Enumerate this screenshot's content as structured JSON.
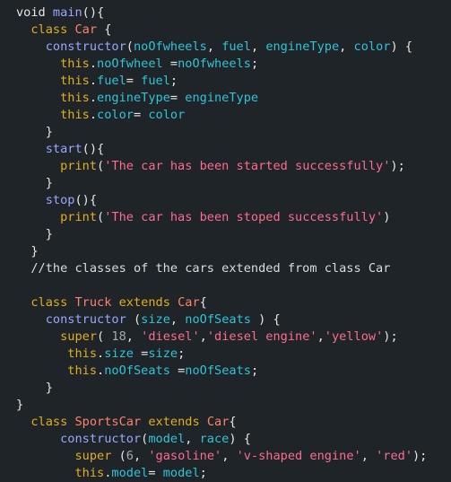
{
  "colors": {
    "background": "#1f2428",
    "plain": "#e6e6e6",
    "keyword": "#e0ae20",
    "function": "#9aa6ff",
    "class_name": "#ff8269",
    "property": "#2fc4d8",
    "string": "#ff6b8f",
    "number": "#a6aab1"
  },
  "lines": [
    [
      {
        "t": "plain",
        "v": "void "
      },
      {
        "t": "fn",
        "v": "main"
      },
      {
        "t": "plain",
        "v": "(){"
      }
    ],
    [
      {
        "t": "plain",
        "v": "  "
      },
      {
        "t": "kw",
        "v": "class"
      },
      {
        "t": "plain",
        "v": " "
      },
      {
        "t": "cls",
        "v": "Car"
      },
      {
        "t": "plain",
        "v": " {"
      }
    ],
    [
      {
        "t": "plain",
        "v": "    "
      },
      {
        "t": "fn",
        "v": "constructor"
      },
      {
        "t": "plain",
        "v": "("
      },
      {
        "t": "attr",
        "v": "noOfwheels"
      },
      {
        "t": "plain",
        "v": ", "
      },
      {
        "t": "attr",
        "v": "fuel"
      },
      {
        "t": "plain",
        "v": ", "
      },
      {
        "t": "attr",
        "v": "engineType"
      },
      {
        "t": "plain",
        "v": ", "
      },
      {
        "t": "attr",
        "v": "color"
      },
      {
        "t": "plain",
        "v": ") {"
      }
    ],
    [
      {
        "t": "plain",
        "v": "      "
      },
      {
        "t": "kw",
        "v": "this"
      },
      {
        "t": "plain",
        "v": "."
      },
      {
        "t": "attr",
        "v": "noOfwheel"
      },
      {
        "t": "plain",
        "v": " ="
      },
      {
        "t": "attr",
        "v": "noOfwheels"
      },
      {
        "t": "plain",
        "v": ";"
      }
    ],
    [
      {
        "t": "plain",
        "v": "      "
      },
      {
        "t": "kw",
        "v": "this"
      },
      {
        "t": "plain",
        "v": "."
      },
      {
        "t": "attr",
        "v": "fuel"
      },
      {
        "t": "plain",
        "v": "= "
      },
      {
        "t": "attr",
        "v": "fuel"
      },
      {
        "t": "plain",
        "v": ";"
      }
    ],
    [
      {
        "t": "plain",
        "v": "      "
      },
      {
        "t": "kw",
        "v": "this"
      },
      {
        "t": "plain",
        "v": "."
      },
      {
        "t": "attr",
        "v": "engineType"
      },
      {
        "t": "plain",
        "v": "= "
      },
      {
        "t": "attr",
        "v": "engineType"
      }
    ],
    [
      {
        "t": "plain",
        "v": "      "
      },
      {
        "t": "kw",
        "v": "this"
      },
      {
        "t": "plain",
        "v": "."
      },
      {
        "t": "attr",
        "v": "color"
      },
      {
        "t": "plain",
        "v": "= "
      },
      {
        "t": "attr",
        "v": "color"
      }
    ],
    [
      {
        "t": "plain",
        "v": "    }"
      }
    ],
    [
      {
        "t": "plain",
        "v": "    "
      },
      {
        "t": "fn",
        "v": "start"
      },
      {
        "t": "plain",
        "v": "(){"
      }
    ],
    [
      {
        "t": "plain",
        "v": "      "
      },
      {
        "t": "kw",
        "v": "print"
      },
      {
        "t": "plain",
        "v": "("
      },
      {
        "t": "str",
        "v": "'The car has been started successfully'"
      },
      {
        "t": "plain",
        "v": ");"
      }
    ],
    [
      {
        "t": "plain",
        "v": "    }"
      }
    ],
    [
      {
        "t": "plain",
        "v": "    "
      },
      {
        "t": "fn",
        "v": "stop"
      },
      {
        "t": "plain",
        "v": "(){"
      }
    ],
    [
      {
        "t": "plain",
        "v": "      "
      },
      {
        "t": "kw",
        "v": "print"
      },
      {
        "t": "plain",
        "v": "("
      },
      {
        "t": "str",
        "v": "'The car has been stoped successfully'"
      },
      {
        "t": "plain",
        "v": ")"
      }
    ],
    [
      {
        "t": "plain",
        "v": "    }"
      }
    ],
    [
      {
        "t": "plain",
        "v": "  }"
      }
    ],
    [
      {
        "t": "comment",
        "v": "  //the classes of the cars extended from class Car"
      }
    ],
    [
      {
        "t": "plain",
        "v": ""
      }
    ],
    [
      {
        "t": "plain",
        "v": "  "
      },
      {
        "t": "kw",
        "v": "class"
      },
      {
        "t": "plain",
        "v": " "
      },
      {
        "t": "cls",
        "v": "Truck"
      },
      {
        "t": "plain",
        "v": " "
      },
      {
        "t": "kw",
        "v": "extends"
      },
      {
        "t": "plain",
        "v": " "
      },
      {
        "t": "cls",
        "v": "Car"
      },
      {
        "t": "plain",
        "v": "{"
      }
    ],
    [
      {
        "t": "plain",
        "v": "    "
      },
      {
        "t": "fn",
        "v": "constructor"
      },
      {
        "t": "plain",
        "v": " ("
      },
      {
        "t": "attr",
        "v": "size"
      },
      {
        "t": "plain",
        "v": ", "
      },
      {
        "t": "attr",
        "v": "noOfSeats"
      },
      {
        "t": "plain",
        "v": " ) {"
      }
    ],
    [
      {
        "t": "plain",
        "v": "      "
      },
      {
        "t": "kw",
        "v": "super"
      },
      {
        "t": "plain",
        "v": "( "
      },
      {
        "t": "num",
        "v": "18"
      },
      {
        "t": "plain",
        "v": ", "
      },
      {
        "t": "str",
        "v": "'diesel'"
      },
      {
        "t": "plain",
        "v": ","
      },
      {
        "t": "str",
        "v": "'diesel engine'"
      },
      {
        "t": "plain",
        "v": ","
      },
      {
        "t": "str",
        "v": "'yellow'"
      },
      {
        "t": "plain",
        "v": ");"
      }
    ],
    [
      {
        "t": "plain",
        "v": "       "
      },
      {
        "t": "kw",
        "v": "this"
      },
      {
        "t": "plain",
        "v": "."
      },
      {
        "t": "attr",
        "v": "size"
      },
      {
        "t": "plain",
        "v": " ="
      },
      {
        "t": "attr",
        "v": "size"
      },
      {
        "t": "plain",
        "v": ";"
      }
    ],
    [
      {
        "t": "plain",
        "v": "       "
      },
      {
        "t": "kw",
        "v": "this"
      },
      {
        "t": "plain",
        "v": "."
      },
      {
        "t": "attr",
        "v": "noOfSeats"
      },
      {
        "t": "plain",
        "v": " ="
      },
      {
        "t": "attr",
        "v": "noOfSeats"
      },
      {
        "t": "plain",
        "v": ";"
      }
    ],
    [
      {
        "t": "plain",
        "v": "    }"
      }
    ],
    [
      {
        "t": "plain",
        "v": "}"
      }
    ],
    [
      {
        "t": "plain",
        "v": "  "
      },
      {
        "t": "kw",
        "v": "class"
      },
      {
        "t": "plain",
        "v": " "
      },
      {
        "t": "cls",
        "v": "SportsCar"
      },
      {
        "t": "plain",
        "v": " "
      },
      {
        "t": "kw",
        "v": "extends"
      },
      {
        "t": "plain",
        "v": " "
      },
      {
        "t": "cls",
        "v": "Car"
      },
      {
        "t": "plain",
        "v": "{"
      }
    ],
    [
      {
        "t": "plain",
        "v": "      "
      },
      {
        "t": "fn",
        "v": "constructor"
      },
      {
        "t": "plain",
        "v": "("
      },
      {
        "t": "attr",
        "v": "model"
      },
      {
        "t": "plain",
        "v": ", "
      },
      {
        "t": "attr",
        "v": "race"
      },
      {
        "t": "plain",
        "v": ") {"
      }
    ],
    [
      {
        "t": "plain",
        "v": "        "
      },
      {
        "t": "kw",
        "v": "super"
      },
      {
        "t": "plain",
        "v": " ("
      },
      {
        "t": "num",
        "v": "6"
      },
      {
        "t": "plain",
        "v": ", "
      },
      {
        "t": "str",
        "v": "'gasoline'"
      },
      {
        "t": "plain",
        "v": ", "
      },
      {
        "t": "str",
        "v": "'v-shaped engine'"
      },
      {
        "t": "plain",
        "v": ", "
      },
      {
        "t": "str",
        "v": "'red'"
      },
      {
        "t": "plain",
        "v": ");"
      }
    ],
    [
      {
        "t": "plain",
        "v": "        "
      },
      {
        "t": "kw",
        "v": "this"
      },
      {
        "t": "plain",
        "v": "."
      },
      {
        "t": "attr",
        "v": "model"
      },
      {
        "t": "plain",
        "v": "= "
      },
      {
        "t": "attr",
        "v": "model"
      },
      {
        "t": "plain",
        "v": ";"
      }
    ]
  ]
}
